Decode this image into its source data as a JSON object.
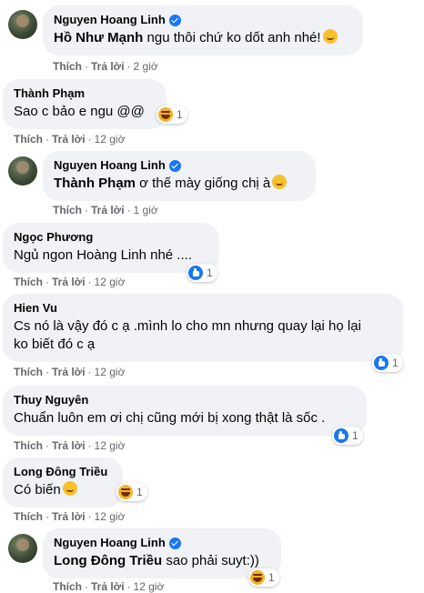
{
  "colors": {
    "bubble": "#f0f2f5",
    "meta": "#65676b",
    "brand": "#1877f2"
  },
  "comments": [
    {
      "author": "Nguyen Hoang Linh",
      "verified": true,
      "tag": "Hồ Như Mạnh",
      "text": " ngu thôi chứ ko dốt anh nhé!",
      "emoji": "grinning-face-icon",
      "like": "Thích",
      "reply": "Trả lời",
      "time": "2 giờ"
    },
    {
      "author": "Thành Phạm",
      "text": "Sao c bảo e ngu @@",
      "reaction": "haha",
      "reaction_count": "1",
      "like": "Thích",
      "reply": "Trả lời",
      "time": "12 giờ"
    },
    {
      "author": "Nguyen Hoang Linh",
      "verified": true,
      "tag": "Thành Phạm",
      "text": " ơ thế mày giống chị à",
      "emoji": "laughing-face-icon",
      "like": "Thích",
      "reply": "Trả lời",
      "time": "1 giờ"
    },
    {
      "author": "Ngọc Phương",
      "text": "Ngủ ngon Hoàng Linh nhé ....",
      "reaction": "like",
      "reaction_count": "1",
      "like": "Thích",
      "reply": "Trả lời",
      "time": "12 giờ"
    },
    {
      "author": "Hien Vu",
      "text_line1": "Cs nó là vậy đó c ạ .mình lo cho mn nhưng quay lại họ lại",
      "text_line2": "ko biết đó c ạ",
      "reaction": "like",
      "reaction_count": "1",
      "like": "Thích",
      "reply": "Trả lời",
      "time": "12 giờ"
    },
    {
      "author": "Thuy Nguyên",
      "text": "Chuẩn luôn em ơi chị cũng mới bị xong thật là sốc .",
      "reaction": "like",
      "reaction_count": "1",
      "like": "Thích",
      "reply": "Trả lời",
      "time": "12 giờ"
    },
    {
      "author": "Long Đông Triều",
      "text": "Có biến",
      "emoji": "astonished-face-icon",
      "reaction": "haha",
      "reaction_count": "1",
      "like": "Thích",
      "reply": "Trả lời",
      "time": "12 giờ"
    },
    {
      "author": "Nguyen Hoang Linh",
      "verified": true,
      "tag": "Long Đông Triều",
      "text": " sao phải suyt:))",
      "reaction": "haha",
      "reaction_count": "1",
      "like": "Thích",
      "reply": "Trả lời",
      "time": "12 giờ"
    }
  ]
}
